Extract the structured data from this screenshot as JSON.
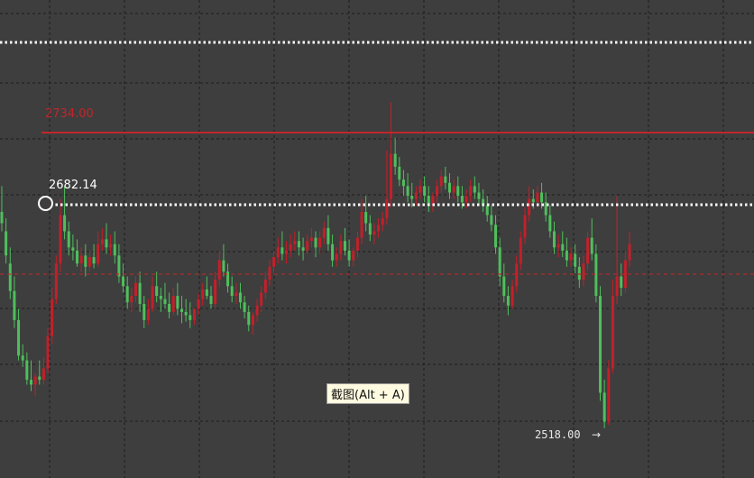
{
  "chart": {
    "price_levels": {
      "top_dotted": {
        "style": "dotted",
        "color": "#ffffff"
      },
      "resistance_level": {
        "label": "2734.00",
        "color": "#c0262c",
        "style": "solid"
      },
      "selected_level": {
        "label": "2682.14",
        "color": "#ffffff",
        "style": "dotted"
      },
      "current_level": {
        "color": "#b02a2a",
        "style": "dashed"
      }
    },
    "low_marker": {
      "label": "2518.00",
      "arrow": "→"
    },
    "tooltip": {
      "text": "截图(Alt + A)"
    },
    "colors": {
      "background": "#3e3e3e",
      "grid": "#1c1c1c",
      "bull": "#c41f2a",
      "bear": "#4fbf5c"
    }
  },
  "chart_data": {
    "type": "candlestick",
    "title": "",
    "xlabel": "",
    "ylabel": "",
    "ylim": [
      2500,
      2790
    ],
    "grid": true,
    "candles": [
      [
        2652,
        2668,
        2645,
        2640
      ],
      [
        2640,
        2648,
        2625,
        2620
      ],
      [
        2620,
        2630,
        2603,
        2598
      ],
      [
        2603,
        2612,
        2585,
        2580
      ],
      [
        2585,
        2592,
        2563,
        2560
      ],
      [
        2563,
        2570,
        2560,
        2556
      ],
      [
        2560,
        2565,
        2548,
        2545
      ],
      [
        2548,
        2560,
        2545,
        2541
      ],
      [
        2545,
        2552,
        2550,
        2538
      ],
      [
        2550,
        2560,
        2548,
        2545
      ],
      [
        2548,
        2562,
        2555,
        2545
      ],
      [
        2555,
        2580,
        2575,
        2552
      ],
      [
        2575,
        2605,
        2598,
        2570
      ],
      [
        2598,
        2625,
        2620,
        2595
      ],
      [
        2620,
        2660,
        2650,
        2615
      ],
      [
        2650,
        2668,
        2640,
        2635
      ],
      [
        2640,
        2646,
        2630,
        2625
      ],
      [
        2630,
        2638,
        2628,
        2622
      ],
      [
        2628,
        2635,
        2620,
        2618
      ],
      [
        2620,
        2630,
        2625,
        2615
      ],
      [
        2625,
        2632,
        2618,
        2612
      ],
      [
        2618,
        2628,
        2624,
        2615
      ],
      [
        2624,
        2632,
        2620,
        2617
      ],
      [
        2620,
        2640,
        2632,
        2618
      ],
      [
        2632,
        2642,
        2635,
        2628
      ],
      [
        2635,
        2645,
        2630,
        2626
      ],
      [
        2630,
        2638,
        2632,
        2625
      ],
      [
        2632,
        2640,
        2625,
        2620
      ],
      [
        2625,
        2632,
        2612,
        2608
      ],
      [
        2612,
        2620,
        2606,
        2602
      ],
      [
        2606,
        2612,
        2596,
        2592
      ],
      [
        2596,
        2605,
        2600,
        2590
      ],
      [
        2600,
        2612,
        2608,
        2596
      ],
      [
        2608,
        2615,
        2595,
        2590
      ],
      [
        2595,
        2600,
        2585,
        2580
      ],
      [
        2585,
        2598,
        2592,
        2582
      ],
      [
        2592,
        2612,
        2606,
        2590
      ],
      [
        2606,
        2615,
        2600,
        2596
      ],
      [
        2600,
        2605,
        2598,
        2590
      ],
      [
        2598,
        2608,
        2595,
        2592
      ],
      [
        2595,
        2602,
        2590,
        2586
      ],
      [
        2590,
        2605,
        2600,
        2588
      ],
      [
        2600,
        2608,
        2592,
        2588
      ],
      [
        2592,
        2600,
        2590,
        2583
      ],
      [
        2590,
        2598,
        2588,
        2584
      ],
      [
        2588,
        2596,
        2585,
        2580
      ],
      [
        2585,
        2592,
        2592,
        2582
      ],
      [
        2592,
        2602,
        2598,
        2588
      ],
      [
        2598,
        2608,
        2604,
        2594
      ],
      [
        2604,
        2612,
        2600,
        2598
      ],
      [
        2600,
        2606,
        2595,
        2592
      ],
      [
        2595,
        2615,
        2610,
        2593
      ],
      [
        2610,
        2628,
        2622,
        2606
      ],
      [
        2622,
        2632,
        2615,
        2612
      ],
      [
        2615,
        2620,
        2606,
        2602
      ],
      [
        2606,
        2612,
        2600,
        2596
      ],
      [
        2600,
        2608,
        2602,
        2595
      ],
      [
        2602,
        2608,
        2596,
        2592
      ],
      [
        2596,
        2600,
        2590,
        2586
      ],
      [
        2590,
        2594,
        2582,
        2578
      ],
      [
        2582,
        2590,
        2588,
        2576
      ],
      [
        2588,
        2598,
        2594,
        2584
      ],
      [
        2594,
        2606,
        2602,
        2590
      ],
      [
        2602,
        2615,
        2610,
        2598
      ],
      [
        2610,
        2622,
        2618,
        2606
      ],
      [
        2618,
        2628,
        2624,
        2614
      ],
      [
        2624,
        2636,
        2630,
        2620
      ],
      [
        2630,
        2640,
        2626,
        2622
      ],
      [
        2626,
        2634,
        2628,
        2620
      ],
      [
        2628,
        2638,
        2632,
        2624
      ],
      [
        2632,
        2640,
        2634,
        2628
      ],
      [
        2634,
        2640,
        2630,
        2625
      ],
      [
        2630,
        2636,
        2628,
        2622
      ],
      [
        2628,
        2638,
        2634,
        2626
      ],
      [
        2634,
        2642,
        2636,
        2630
      ],
      [
        2636,
        2640,
        2630,
        2624
      ],
      [
        2630,
        2640,
        2636,
        2626
      ],
      [
        2636,
        2646,
        2642,
        2632
      ],
      [
        2642,
        2650,
        2632,
        2628
      ],
      [
        2632,
        2638,
        2622,
        2618
      ],
      [
        2622,
        2630,
        2626,
        2618
      ],
      [
        2626,
        2638,
        2634,
        2622
      ],
      [
        2634,
        2642,
        2628,
        2625
      ],
      [
        2628,
        2635,
        2622,
        2618
      ],
      [
        2622,
        2630,
        2628,
        2618
      ],
      [
        2628,
        2640,
        2636,
        2624
      ],
      [
        2636,
        2660,
        2652,
        2632
      ],
      [
        2652,
        2662,
        2645,
        2640
      ],
      [
        2645,
        2650,
        2638,
        2634
      ],
      [
        2638,
        2645,
        2640,
        2632
      ],
      [
        2640,
        2648,
        2644,
        2636
      ],
      [
        2644,
        2652,
        2648,
        2640
      ],
      [
        2648,
        2690,
        2660,
        2644
      ],
      [
        2660,
        2720,
        2688,
        2655
      ],
      [
        2688,
        2698,
        2680,
        2675
      ],
      [
        2680,
        2686,
        2672,
        2668
      ],
      [
        2672,
        2678,
        2668,
        2662
      ],
      [
        2668,
        2676,
        2662,
        2658
      ],
      [
        2662,
        2670,
        2660,
        2655
      ],
      [
        2660,
        2668,
        2664,
        2656
      ],
      [
        2664,
        2672,
        2668,
        2660
      ],
      [
        2668,
        2674,
        2662,
        2658
      ],
      [
        2662,
        2668,
        2656,
        2652
      ],
      [
        2656,
        2664,
        2662,
        2652
      ],
      [
        2662,
        2672,
        2668,
        2658
      ],
      [
        2668,
        2678,
        2674,
        2664
      ],
      [
        2674,
        2680,
        2670,
        2666
      ],
      [
        2670,
        2676,
        2664,
        2660
      ],
      [
        2664,
        2672,
        2668,
        2660
      ],
      [
        2668,
        2674,
        2662,
        2658
      ],
      [
        2662,
        2668,
        2658,
        2654
      ],
      [
        2658,
        2666,
        2662,
        2654
      ],
      [
        2662,
        2672,
        2668,
        2658
      ],
      [
        2668,
        2674,
        2664,
        2660
      ],
      [
        2664,
        2670,
        2660,
        2656
      ],
      [
        2660,
        2666,
        2656,
        2652
      ],
      [
        2656,
        2662,
        2650,
        2646
      ],
      [
        2650,
        2656,
        2644,
        2640
      ],
      [
        2644,
        2650,
        2630,
        2626
      ],
      [
        2630,
        2636,
        2612,
        2606
      ],
      [
        2612,
        2620,
        2600,
        2596
      ],
      [
        2600,
        2606,
        2594,
        2588
      ],
      [
        2594,
        2610,
        2606,
        2592
      ],
      [
        2606,
        2625,
        2620,
        2602
      ],
      [
        2620,
        2640,
        2636,
        2616
      ],
      [
        2636,
        2655,
        2650,
        2632
      ],
      [
        2650,
        2668,
        2660,
        2646
      ],
      [
        2660,
        2666,
        2658,
        2654
      ],
      [
        2658,
        2668,
        2664,
        2655
      ],
      [
        2664,
        2670,
        2658,
        2654
      ],
      [
        2658,
        2664,
        2650,
        2646
      ],
      [
        2650,
        2656,
        2640,
        2636
      ],
      [
        2640,
        2646,
        2630,
        2626
      ],
      [
        2630,
        2638,
        2632,
        2624
      ],
      [
        2632,
        2640,
        2628,
        2624
      ],
      [
        2628,
        2636,
        2622,
        2618
      ],
      [
        2622,
        2630,
        2626,
        2618
      ],
      [
        2626,
        2632,
        2618,
        2614
      ],
      [
        2618,
        2624,
        2610,
        2605
      ],
      [
        2610,
        2625,
        2620,
        2606
      ],
      [
        2620,
        2640,
        2636,
        2616
      ],
      [
        2636,
        2648,
        2626,
        2622
      ],
      [
        2626,
        2632,
        2600,
        2596
      ],
      [
        2600,
        2606,
        2540,
        2535
      ],
      [
        2540,
        2548,
        2522,
        2518
      ],
      [
        2522,
        2560,
        2555,
        2520
      ],
      [
        2555,
        2610,
        2600,
        2552
      ],
      [
        2600,
        2662,
        2612,
        2595
      ],
      [
        2612,
        2620,
        2605,
        2600
      ],
      [
        2605,
        2628,
        2622,
        2602
      ],
      [
        2622,
        2640,
        2632,
        2618
      ]
    ]
  }
}
